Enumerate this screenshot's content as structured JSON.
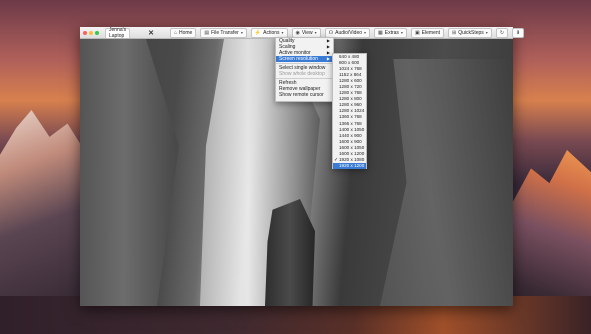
{
  "window": {
    "tab_title": "Jenna's Laptop",
    "toolbar": {
      "home": "Home",
      "file_transfer": "File Transfer",
      "actions": "Actions",
      "view": "View",
      "audio_video": "Audio/Video",
      "extras": "Extras",
      "element": "Element",
      "quickssteps": "QuickSteps"
    }
  },
  "view_menu": {
    "items": [
      {
        "label": "Quality",
        "submenu": true
      },
      {
        "label": "Scaling",
        "submenu": true
      },
      {
        "label": "Active monitor",
        "submenu": true
      },
      {
        "label": "Screen resolution",
        "submenu": true,
        "active": true
      },
      {
        "label": "Select single window"
      },
      {
        "label": "Show whole desktop",
        "disabled": true
      },
      {
        "label": "Refresh"
      },
      {
        "label": "Remove wallpaper"
      },
      {
        "label": "Show remote cursor"
      }
    ]
  },
  "resolution_menu": {
    "items": [
      "640 x 480",
      "800 x 600",
      "1024 x 768",
      "1152 x 864",
      "1280 x 600",
      "1280 x 720",
      "1280 x 768",
      "1280 x 800",
      "1280 x 960",
      "1280 x 1024",
      "1360 x 768",
      "1366 x 768",
      "1400 x 1050",
      "1440 x 900",
      "1600 x 900",
      "1600 x 1050",
      "1600 x 1200",
      "1920 x 1080",
      "1920 x 1200"
    ],
    "checked_index": 17,
    "selected": "1920 x 1200",
    "check_glyph": "✓"
  }
}
